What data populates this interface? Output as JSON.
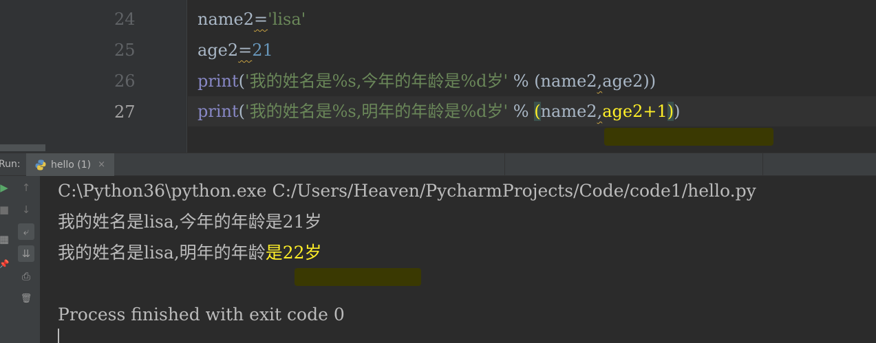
{
  "editor": {
    "line_numbers": [
      "24",
      "25",
      "26",
      "27"
    ],
    "current_line": "27",
    "lines": [
      {
        "p1": "name2",
        "eq": "=",
        "p2": "'lisa'"
      },
      {
        "p1": "age2",
        "eq": "=",
        "p2": "21"
      },
      {
        "kw": "print",
        "open": "(",
        "str": "'我的姓名是%s,今年的年龄是%d岁'",
        "mid": " % (name2",
        "comma": ",",
        "rest": "age2))"
      },
      {
        "kw": "print",
        "open": "(",
        "str": "'我的姓名是%s,明年的年龄是%d岁'",
        "mid": " % ",
        "lp": "(",
        "a": "name2",
        "comma": ",",
        "b": "age2+1",
        "rp": ")",
        "close": ")"
      }
    ]
  },
  "run": {
    "label": "Run:",
    "tab_title": "hello (1)",
    "tab_close": "×",
    "tab_icon": "python-icon"
  },
  "toolbar": {
    "rerun": "▶",
    "stop": "■",
    "up": "↑",
    "down": "↓",
    "wrap": "⤶",
    "scroll_end": "⇊",
    "print": "⎙",
    "trash": "🗑",
    "layout": "▦",
    "pin": "📌"
  },
  "console": {
    "command": "C:\\Python36\\python.exe C:/Users/Heaven/PycharmProjects/Code/code1/hello.py",
    "line1": "我的姓名是lisa,今年的年龄是21岁",
    "line2_a": "我的姓名是lisa,明年的年龄",
    "line2_b": "是22岁",
    "finish": "Process finished with exit code 0"
  },
  "colors": {
    "background": "#2b2b2b",
    "keyword": "#8888c6",
    "string": "#6a8759",
    "number": "#6897bb",
    "highlight": "#ffef28"
  }
}
